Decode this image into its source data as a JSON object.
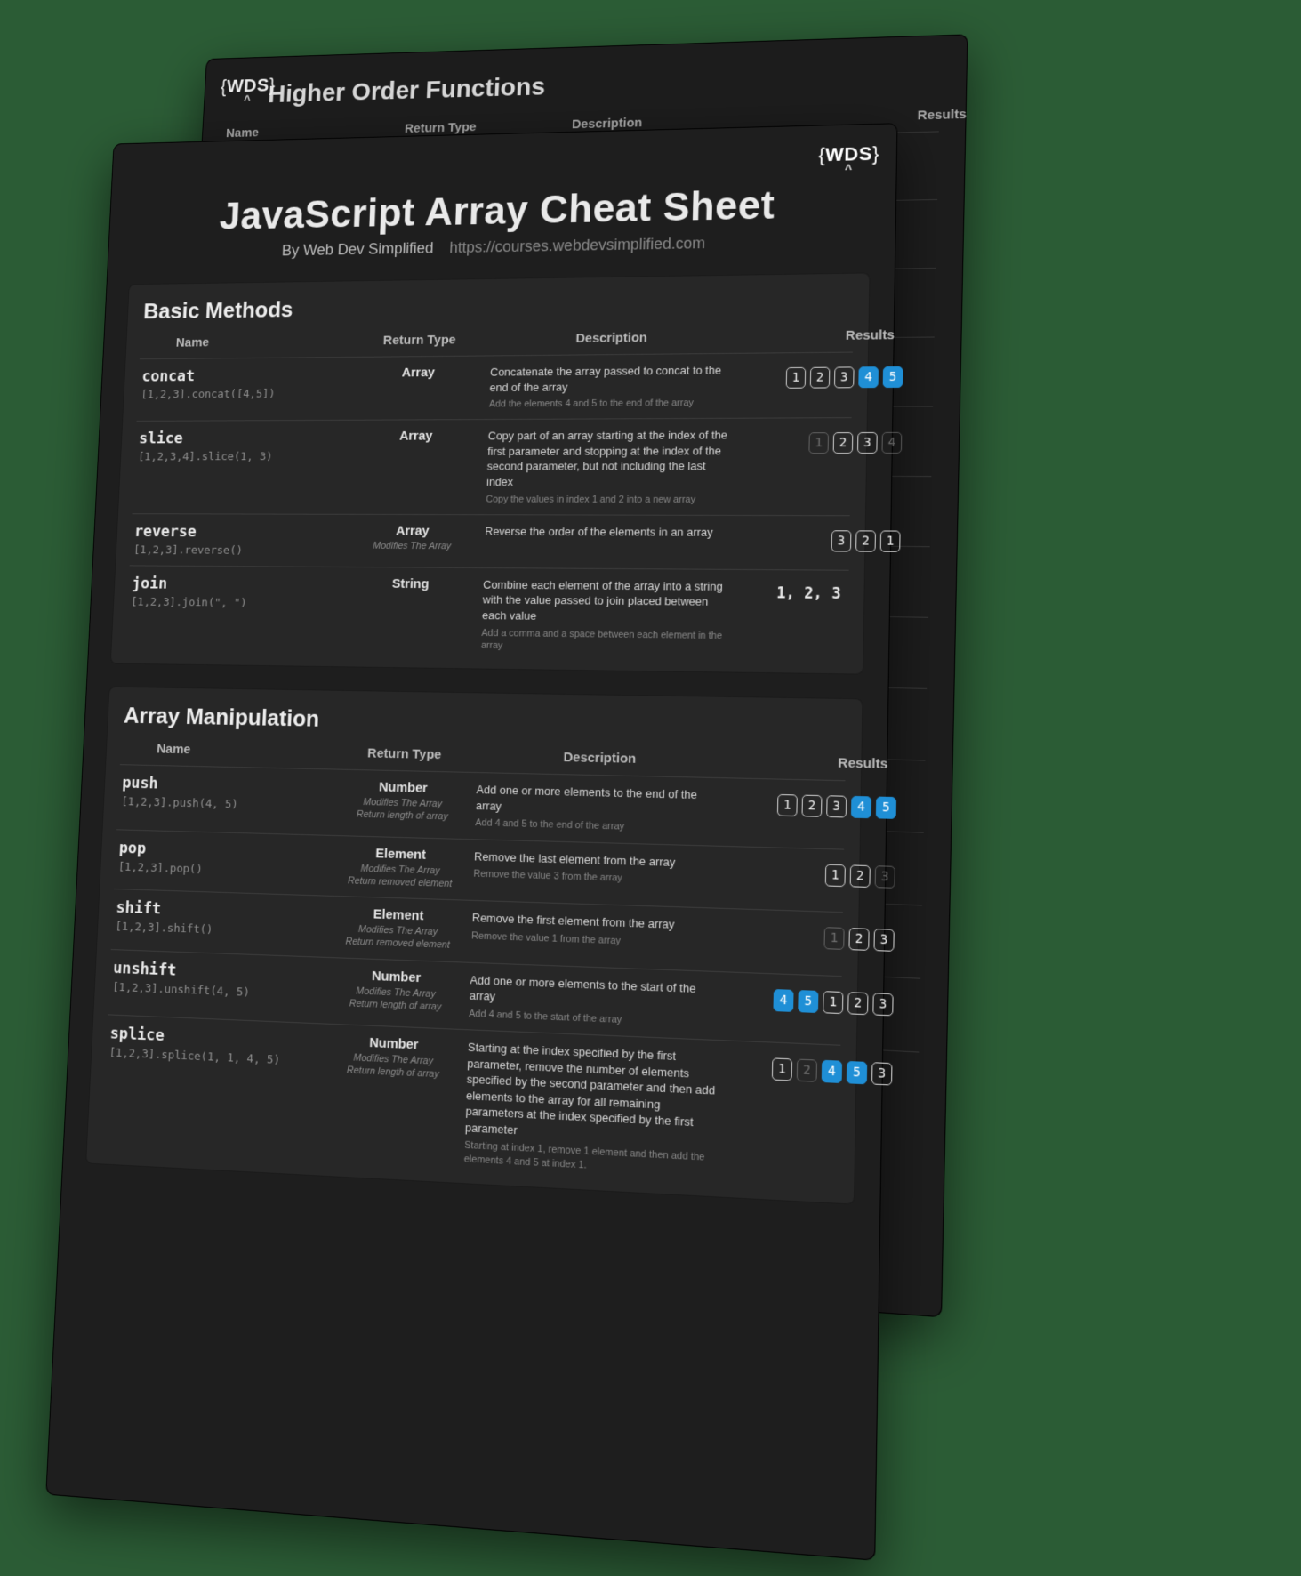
{
  "logo_text": "WDS",
  "back_page": {
    "title": "Higher Order Functions",
    "columns": [
      "Name",
      "Return Type",
      "Description",
      "Results"
    ]
  },
  "front_page": {
    "title": "JavaScript Array Cheat Sheet",
    "byline": "By Web Dev Simplified",
    "url": "https://courses.webdevsimplified.com",
    "sections": [
      {
        "heading": "Basic Methods",
        "columns": [
          "Name",
          "Return Type",
          "Description",
          "Results"
        ],
        "rows": [
          {
            "name": "concat",
            "code": "[1,2,3].concat([4,5])",
            "rtype": "Array",
            "rtype_sub": "",
            "desc": "Concatenate the array passed to concat to the end of the array",
            "desc_sub": "Add the elements 4 and 5 to the end of the array",
            "result_type": "chips",
            "chips": [
              {
                "v": "1"
              },
              {
                "v": "2"
              },
              {
                "v": "3"
              },
              {
                "v": "4",
                "style": "accent"
              },
              {
                "v": "5",
                "style": "accent"
              }
            ]
          },
          {
            "name": "slice",
            "code": "[1,2,3,4].slice(1, 3)",
            "rtype": "Array",
            "rtype_sub": "",
            "desc": "Copy part of an array starting at the index of the first parameter and stopping at the index of the second parameter, but not including the last index",
            "desc_sub": "Copy the values in index 1 and 2 into a new array",
            "result_type": "chips",
            "chips": [
              {
                "v": "1",
                "style": "dim"
              },
              {
                "v": "2"
              },
              {
                "v": "3"
              },
              {
                "v": "4",
                "style": "dim"
              }
            ]
          },
          {
            "name": "reverse",
            "code": "[1,2,3].reverse()",
            "rtype": "Array",
            "rtype_sub": "Modifies The Array",
            "desc": "Reverse the order of the elements in an array",
            "desc_sub": "",
            "result_type": "chips",
            "chips": [
              {
                "v": "3"
              },
              {
                "v": "2"
              },
              {
                "v": "1"
              }
            ]
          },
          {
            "name": "join",
            "code": "[1,2,3].join(\", \")",
            "rtype": "String",
            "rtype_sub": "",
            "desc": "Combine each element of the array into a string with the value passed to join placed between each value",
            "desc_sub": "Add a comma and a space between each element in the array",
            "result_type": "text",
            "result_text": "1, 2, 3"
          }
        ]
      },
      {
        "heading": "Array Manipulation",
        "columns": [
          "Name",
          "Return Type",
          "Description",
          "Results"
        ],
        "rows": [
          {
            "name": "push",
            "code": "[1,2,3].push(4, 5)",
            "rtype": "Number",
            "rtype_sub": "Modifies The Array\nReturn length of array",
            "desc": "Add one or more elements to the end of the array",
            "desc_sub": "Add 4 and 5 to the end of the array",
            "result_type": "chips",
            "chips": [
              {
                "v": "1"
              },
              {
                "v": "2"
              },
              {
                "v": "3"
              },
              {
                "v": "4",
                "style": "accent"
              },
              {
                "v": "5",
                "style": "accent"
              }
            ]
          },
          {
            "name": "pop",
            "code": "[1,2,3].pop()",
            "rtype": "Element",
            "rtype_sub": "Modifies The Array\nReturn removed element",
            "desc": "Remove the last element from the array",
            "desc_sub": "Remove the value 3 from the array",
            "result_type": "chips",
            "chips": [
              {
                "v": "1"
              },
              {
                "v": "2"
              },
              {
                "v": "3",
                "style": "dim"
              }
            ]
          },
          {
            "name": "shift",
            "code": "[1,2,3].shift()",
            "rtype": "Element",
            "rtype_sub": "Modifies The Array\nReturn removed element",
            "desc": "Remove the first element from the array",
            "desc_sub": "Remove the value 1 from the array",
            "result_type": "chips",
            "chips": [
              {
                "v": "1",
                "style": "dim"
              },
              {
                "v": "2"
              },
              {
                "v": "3"
              }
            ]
          },
          {
            "name": "unshift",
            "code": "[1,2,3].unshift(4, 5)",
            "rtype": "Number",
            "rtype_sub": "Modifies The Array\nReturn length of array",
            "desc": "Add one or more elements to the start of the array",
            "desc_sub": "Add 4 and 5 to the start of the array",
            "result_type": "chips",
            "chips": [
              {
                "v": "4",
                "style": "accent"
              },
              {
                "v": "5",
                "style": "accent"
              },
              {
                "v": "1"
              },
              {
                "v": "2"
              },
              {
                "v": "3"
              }
            ]
          },
          {
            "name": "splice",
            "code": "[1,2,3].splice(1, 1, 4, 5)",
            "rtype": "Number",
            "rtype_sub": "Modifies The Array\nReturn length of array",
            "desc": "Starting at the index specified by the first parameter, remove the number of elements specified by the second parameter and then add elements to the array for all remaining parameters at the index specified by the first parameter",
            "desc_sub": "Starting at index 1, remove 1 element and then add the elements 4 and 5 at index 1.",
            "result_type": "chips",
            "chips": [
              {
                "v": "1"
              },
              {
                "v": "2",
                "style": "dim"
              },
              {
                "v": "4",
                "style": "accent"
              },
              {
                "v": "5",
                "style": "accent"
              },
              {
                "v": "3"
              }
            ]
          }
        ]
      }
    ]
  }
}
